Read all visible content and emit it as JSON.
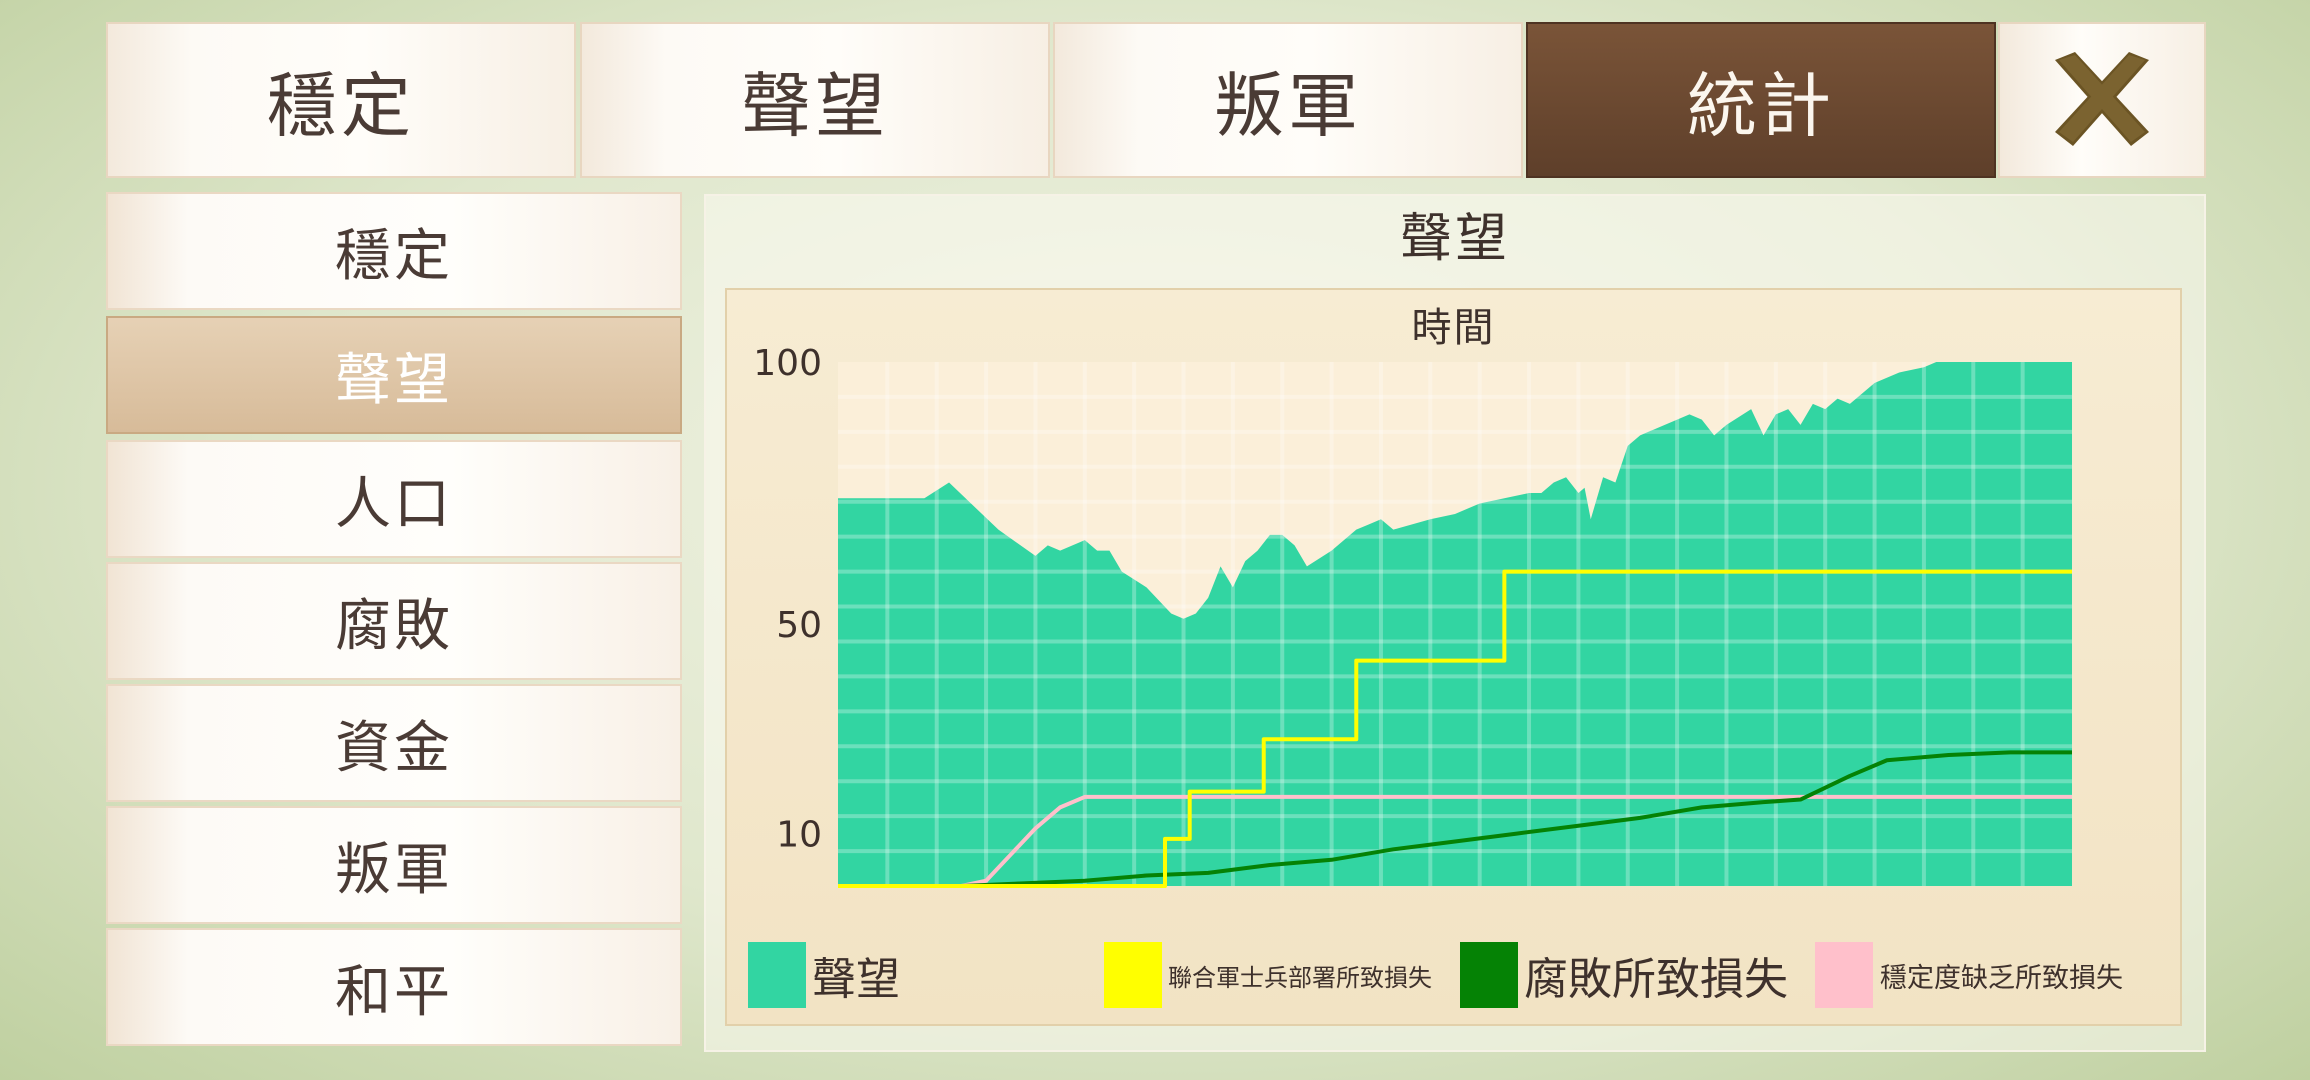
{
  "top_tabs": [
    {
      "label": "穩定",
      "active": false
    },
    {
      "label": "聲望",
      "active": false
    },
    {
      "label": "叛軍",
      "active": false
    },
    {
      "label": "統計",
      "active": true
    }
  ],
  "close_icon": "close-x-icon",
  "sidebar": {
    "items": [
      {
        "label": "穩定",
        "active": false
      },
      {
        "label": "聲望",
        "active": true
      },
      {
        "label": "人口",
        "active": false
      },
      {
        "label": "腐敗",
        "active": false
      },
      {
        "label": "資金",
        "active": false
      },
      {
        "label": "叛軍",
        "active": false
      },
      {
        "label": "和平",
        "active": false
      }
    ]
  },
  "panel": {
    "title": "聲望"
  },
  "chart_data": {
    "type": "area",
    "title": "時間",
    "ylim": [
      0,
      100
    ],
    "y_ticks": [
      "100",
      "50",
      "10"
    ],
    "grid": true,
    "legend_position": "bottom",
    "colors": {
      "reputation": "#32d5a2",
      "army_loss": "#ffff00",
      "corruption_loss": "#058205",
      "stability_loss": "#ffc0cb"
    },
    "series": [
      {
        "name": "聲望",
        "style": "area",
        "x": [
          0,
          7,
          9,
          13,
          16,
          17,
          18,
          20,
          21,
          22,
          23,
          25,
          27,
          28,
          29,
          30,
          31,
          32,
          33,
          34,
          35,
          36,
          37,
          38,
          40,
          42,
          43,
          44,
          45,
          48,
          50,
          52,
          54,
          56,
          57,
          58,
          59,
          60,
          60.5,
          61,
          62,
          63,
          64,
          65,
          67,
          69,
          70,
          71,
          72,
          74,
          75,
          76,
          77,
          78,
          79,
          80,
          81,
          82,
          84,
          86,
          88,
          89,
          90,
          92,
          93,
          95,
          96,
          98,
          100
        ],
        "values": [
          74,
          74,
          77,
          68,
          63,
          65,
          64,
          66,
          64,
          64,
          60,
          57,
          52,
          51,
          52,
          55,
          61,
          57,
          62,
          64,
          67,
          67,
          65,
          61,
          64,
          68,
          69,
          70,
          68,
          70,
          71,
          73,
          74,
          75,
          75,
          77,
          78,
          75,
          76,
          70,
          78,
          77,
          84,
          86,
          88,
          90,
          89,
          86,
          88,
          91,
          86,
          90,
          91,
          88,
          92,
          91,
          93,
          92,
          96,
          98,
          99,
          100,
          100,
          100,
          100,
          100,
          100,
          100,
          100
        ]
      },
      {
        "name": "聯合軍士兵部署所致損失",
        "style": "step",
        "x": [
          0,
          14,
          26.5,
          28.5,
          34.5,
          42,
          54,
          61,
          100
        ],
        "values": [
          0,
          0,
          9,
          18,
          28,
          43,
          60,
          60,
          60
        ]
      },
      {
        "name": "腐敗所致損失",
        "style": "line",
        "x": [
          0,
          10,
          15,
          20,
          25,
          30,
          35,
          40,
          45,
          50,
          55,
          60,
          65,
          70,
          75,
          78,
          82,
          85,
          90,
          95,
          100
        ],
        "values": [
          0,
          0,
          0.5,
          1,
          2,
          2.5,
          4,
          5,
          7,
          8.5,
          10,
          11.5,
          13,
          15,
          16,
          16.5,
          21,
          24,
          25,
          25.5,
          25.5
        ]
      },
      {
        "name": "穩定度缺乏所致損失",
        "style": "line",
        "x": [
          0,
          10,
          12,
          14,
          16,
          18,
          20,
          40,
          60,
          80,
          100
        ],
        "values": [
          0,
          0,
          1,
          6,
          11,
          15,
          17,
          17,
          17,
          17,
          17
        ]
      }
    ]
  }
}
